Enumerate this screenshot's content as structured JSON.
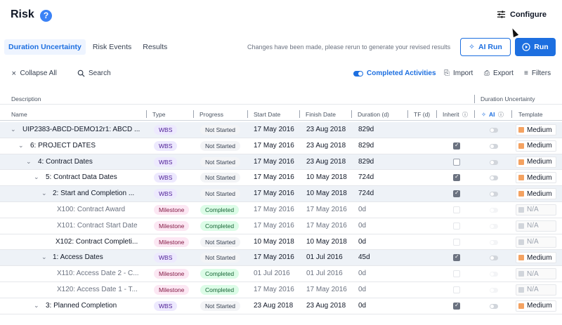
{
  "header": {
    "title": "Risk",
    "help": "?",
    "configure_label": "Configure"
  },
  "tabs": [
    {
      "label": "Duration Uncertainty"
    },
    {
      "label": "Risk Events"
    },
    {
      "label": "Results"
    }
  ],
  "notice": "Changes have been made, please rerun to generate your revised results",
  "buttons": {
    "ai_run": "AI Run",
    "run": "Run"
  },
  "toolbar": {
    "collapse_all": "Collapse All",
    "search": "Search",
    "completed_activities": "Completed Activities",
    "import": "Import",
    "export": "Export",
    "filters": "Filters"
  },
  "group_headers": {
    "description": "Description",
    "duration_uncertainty": "Duration Uncertainty"
  },
  "columns": {
    "name": "Name",
    "type": "Type",
    "progress": "Progress",
    "start": "Start Date",
    "finish": "Finish Date",
    "duration": "Duration (d)",
    "tf": "TF (d)",
    "inherit": "Inherit",
    "ai": "AI",
    "template": "Template"
  },
  "colors": {
    "accent": "#1d6fe0",
    "medium": "#f4a261",
    "na": "#d1d5db"
  },
  "rows": [
    {
      "name": "UIP2383-ABCD-DEMO12r1: ABCD ...",
      "type": "WBS",
      "progress": "Not Started",
      "start": "17 May 2016",
      "finish": "23 Aug 2018",
      "duration": "829d",
      "template": "Medium"
    },
    {
      "name": "6: PROJECT DATES",
      "type": "WBS",
      "progress": "Not Started",
      "start": "17 May 2016",
      "finish": "23 Aug 2018",
      "duration": "829d",
      "template": "Medium"
    },
    {
      "name": "4: Contract Dates",
      "type": "WBS",
      "progress": "Not Started",
      "start": "17 May 2016",
      "finish": "23 Aug 2018",
      "duration": "829d",
      "template": "Medium"
    },
    {
      "name": "5: Contract Data Dates",
      "type": "WBS",
      "progress": "Not Started",
      "start": "17 May 2016",
      "finish": "10 May 2018",
      "duration": "724d",
      "template": "Medium"
    },
    {
      "name": "2: Start and Completion ...",
      "type": "WBS",
      "progress": "Not Started",
      "start": "17 May 2016",
      "finish": "10 May 2018",
      "duration": "724d",
      "template": "Medium"
    },
    {
      "name": "X100: Contract Award",
      "type": "Milestone",
      "progress": "Completed",
      "start": "17 May 2016",
      "finish": "17 May 2016",
      "duration": "0d",
      "template": "N/A"
    },
    {
      "name": "X101: Contract Start Date",
      "type": "Milestone",
      "progress": "Completed",
      "start": "17 May 2016",
      "finish": "17 May 2016",
      "duration": "0d",
      "template": "N/A"
    },
    {
      "name": "X102: Contract Completi...",
      "type": "Milestone",
      "progress": "Not Started",
      "start": "10 May 2018",
      "finish": "10 May 2018",
      "duration": "0d",
      "template": "N/A"
    },
    {
      "name": "1: Access Dates",
      "type": "WBS",
      "progress": "Not Started",
      "start": "17 May 2016",
      "finish": "01 Jul 2016",
      "duration": "45d",
      "template": "Medium"
    },
    {
      "name": "X110: Access Date 2 - C...",
      "type": "Milestone",
      "progress": "Completed",
      "start": "01 Jul 2016",
      "finish": "01 Jul 2016",
      "duration": "0d",
      "template": "N/A"
    },
    {
      "name": "X120: Access Date 1 - T...",
      "type": "Milestone",
      "progress": "Completed",
      "start": "17 May 2016",
      "finish": "17 May 2016",
      "duration": "0d",
      "template": "N/A"
    },
    {
      "name": "3: Planned Completion",
      "type": "WBS",
      "progress": "Not Started",
      "start": "23 Aug 2018",
      "finish": "23 Aug 2018",
      "duration": "0d",
      "template": "Medium"
    }
  ]
}
